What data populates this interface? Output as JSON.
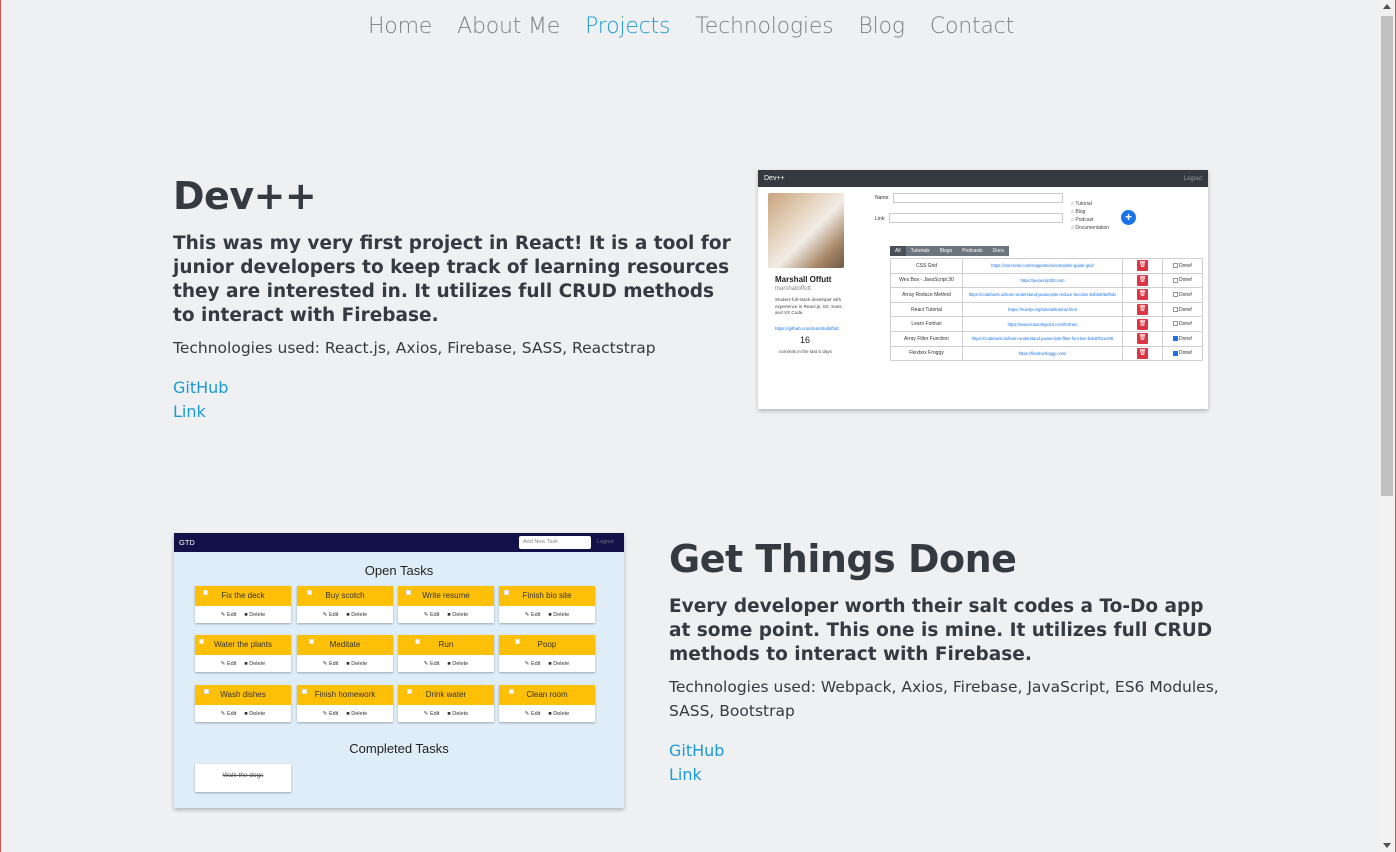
{
  "nav": {
    "items": [
      {
        "label": "Home"
      },
      {
        "label": "About Me"
      },
      {
        "label": "Projects"
      },
      {
        "label": "Technologies"
      },
      {
        "label": "Blog"
      },
      {
        "label": "Contact"
      }
    ],
    "active": "Projects"
  },
  "projects": [
    {
      "title": "Dev++",
      "description": "This was my very first project in React! It is a tool for junior developers to keep track of learning resources they are interested in. It utilizes full CRUD methods to interact with Firebase.",
      "technologies": "Technologies used: React.js, Axios, Firebase, SASS, Reactstrap",
      "github_label": "GitHub",
      "link_label": "Link",
      "screenshot": {
        "app_name": "Dev++",
        "logout": "Logout",
        "user_name": "Marshall Offutt",
        "user_handle": "marshalloffutt",
        "bio": "Student full-stack developer with experience in React.js, Git, Sass, and VS Code.",
        "github_url": "https://github.com/marshalloffutt",
        "commit_count": "16",
        "commit_label": "commits in the last 5 days",
        "name_label": "Name:",
        "link_label": "Link:",
        "radio_options": [
          "Tutorial",
          "Blog",
          "Podcast",
          "Documentation"
        ],
        "tabs": [
          "All",
          "Tutorials",
          "Blogs",
          "Podcasts",
          "Docs"
        ],
        "done_label": "Done!",
        "rows": [
          {
            "title": "CSS Grid",
            "url": "https://css-tricks.com/snippets/css/complete-guide-grid/",
            "done": false
          },
          {
            "title": "Wes Bos - JavaScript 30",
            "url": "https://javascript30.com",
            "done": false
          },
          {
            "title": "Array Reduce Method",
            "url": "https://codeburst.io/learn-understand-javascripts-reduce-function-b2b0406efbdc",
            "done": false
          },
          {
            "title": "React Tutorial",
            "url": "https://reactjs.org/tutorial/tutorial.html",
            "done": false
          },
          {
            "title": "Learn Fortran",
            "url": "https://www.tutorialspoint.com/fortran/",
            "done": false
          },
          {
            "title": "Array Filter Function",
            "url": "https://codeburst.io/learn-understand-javascripts-filter-function-bde87bce206",
            "done": true
          },
          {
            "title": "Flexbox Froggy",
            "url": "https://flexboxfroggy.com/",
            "done": true
          }
        ]
      }
    },
    {
      "title": "Get Things Done",
      "description": "Every developer worth their salt codes a To-Do app at some point. This one is mine. It utilizes full CRUD methods to interact with Firebase.",
      "technologies": "Technologies used: Webpack, Axios, Firebase, JavaScript, ES6 Modules, SASS, Bootstrap",
      "github_label": "GitHub",
      "link_label": "Link",
      "screenshot": {
        "app_name": "GTD",
        "search_placeholder": "Add New Task",
        "logout": "Logout",
        "open_heading": "Open Tasks",
        "completed_heading": "Completed Tasks",
        "edit_label": "Edit",
        "delete_label": "Delete",
        "open_tasks": [
          "Fix the deck",
          "Buy scotch",
          "Write resume",
          "Finish bio site",
          "Water the plants",
          "Meditate",
          "Run",
          "Poop",
          "Wash dishes",
          "Finish homework",
          "Drink water",
          "Clean room"
        ],
        "completed_tasks": [
          "Walk the dogs"
        ]
      }
    }
  ],
  "colors": {
    "background": "#eff0f2",
    "accent": "#1a9bd7",
    "task_card": "#fdc006",
    "gtd_navbar": "#121149",
    "devpp_navbar": "#343a40",
    "delete_red": "#dc3545"
  }
}
